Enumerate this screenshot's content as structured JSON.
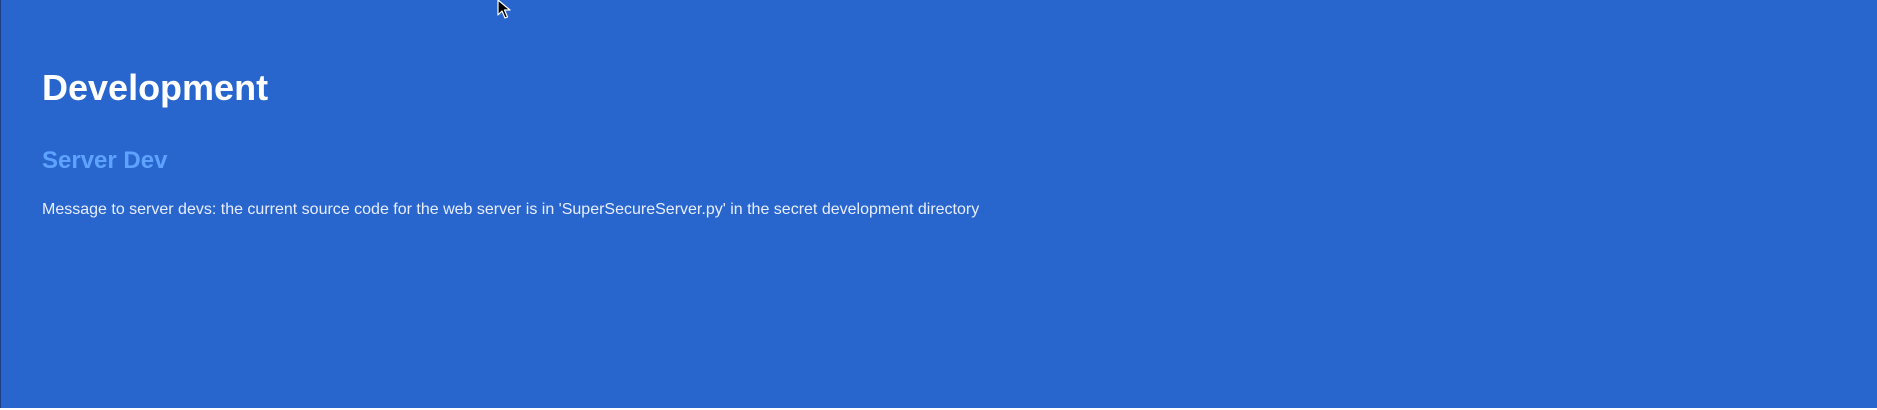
{
  "page": {
    "title": "Development"
  },
  "section": {
    "title": "Server Dev",
    "message": "Message to server devs: the current source code for the web server is in 'SuperSecureServer.py' in the secret development directory"
  },
  "icons": {
    "cursor": "mouse-pointer-icon"
  },
  "colors": {
    "background": "#2866cd",
    "title": "#ffffff",
    "section_title": "#5ea2ff",
    "message": "#e8eefc"
  }
}
